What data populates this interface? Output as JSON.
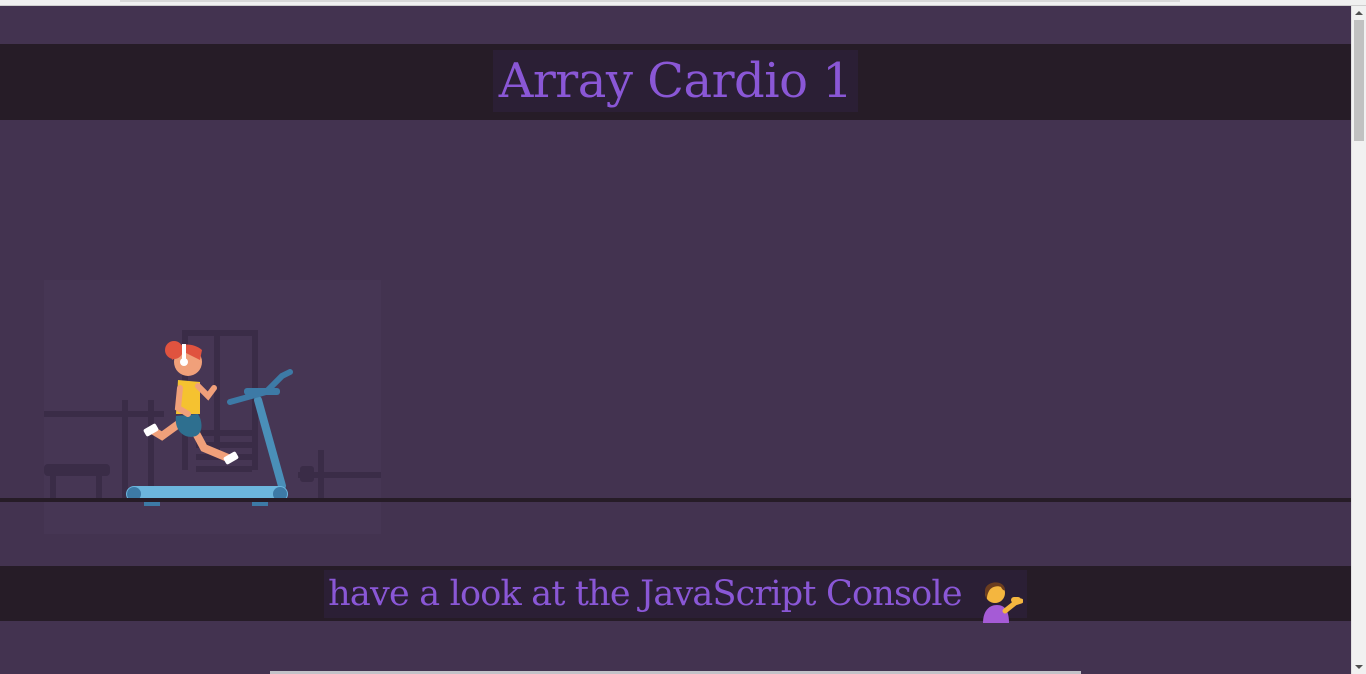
{
  "page": {
    "title": "Array Cardio 1",
    "footer_text": "have a look at the JavaScript Console"
  },
  "icons": {
    "footer_emoji": "person-tipping-hand-icon",
    "hero": "treadmill-runner-illustration"
  },
  "colors": {
    "background": "#433350",
    "band": "#261c27",
    "accent_text": "#8a57d6"
  }
}
